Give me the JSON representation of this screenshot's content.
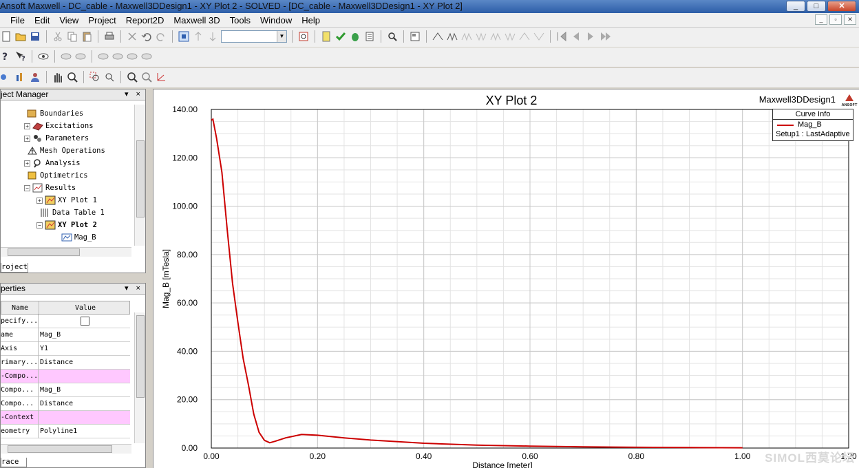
{
  "window": {
    "title": "Ansoft Maxwell - DC_cable - Maxwell3DDesign1 - XY Plot 2 - SOLVED - [DC_cable - Maxwell3DDesign1 - XY Plot 2]",
    "min": "_",
    "max": "□",
    "close": "✕"
  },
  "menu": {
    "items": [
      "File",
      "Edit",
      "View",
      "Project",
      "Report2D",
      "Maxwell 3D",
      "Tools",
      "Window",
      "Help"
    ],
    "mdi": [
      "_",
      "▫",
      "✕"
    ]
  },
  "project_manager": {
    "header": "ject Manager",
    "buttons": "▾ ×",
    "tree": [
      {
        "label": "Boundaries",
        "expand": ""
      },
      {
        "label": "Excitations",
        "expand": "+"
      },
      {
        "label": "Parameters",
        "expand": "+"
      },
      {
        "label": "Mesh Operations",
        "expand": ""
      },
      {
        "label": "Analysis",
        "expand": "+"
      },
      {
        "label": "Optimetrics",
        "expand": ""
      },
      {
        "label": "Results",
        "expand": "−"
      },
      {
        "label": "XY Plot 1",
        "expand": "+"
      },
      {
        "label": "Data Table 1",
        "expand": ""
      },
      {
        "label": "XY Plot 2",
        "expand": "−"
      },
      {
        "label": "Mag_B",
        "expand": ""
      }
    ],
    "tab": "roject"
  },
  "properties": {
    "header": "perties",
    "buttons": "▾ ×",
    "columns": [
      "Name",
      "Value"
    ],
    "rows": [
      {
        "name": "pecify...",
        "value": ""
      },
      {
        "name": "ame",
        "value": "Mag_B"
      },
      {
        "name": " Axis",
        "value": "Y1"
      },
      {
        "name": "rimary...",
        "value": "Distance"
      },
      {
        "name": "-Compo...",
        "value": ""
      },
      {
        "name": " Compo...",
        "value": "Mag_B"
      },
      {
        "name": " Compo...",
        "value": "Distance"
      },
      {
        "name": "-Context",
        "value": ""
      },
      {
        "name": "eometry",
        "value": "Polyline1"
      }
    ],
    "tab": "race"
  },
  "plot": {
    "design": "Maxwell3DDesign1",
    "logo_text": "ANSOFT",
    "legend_title": "Curve Info",
    "legend_series": "Mag_B",
    "legend_setup": "Setup1 : LastAdaptive",
    "watermark": "SIMOL西莫论坛",
    "line_color": "#cc0000"
  },
  "chart_data": {
    "type": "line",
    "title": "XY Plot 2",
    "xlabel": "Distance [meter]",
    "ylabel": "Mag_B [mTesla]",
    "xlim": [
      0,
      1.2
    ],
    "ylim": [
      0,
      140
    ],
    "xticks": [
      "0.00",
      "0.20",
      "0.40",
      "0.60",
      "0.80",
      "1.00",
      "1.20"
    ],
    "yticks": [
      "0.00",
      "20.00",
      "40.00",
      "60.00",
      "80.00",
      "100.00",
      "120.00",
      "140.00"
    ],
    "grid": true,
    "legend_position": "top-right",
    "series": [
      {
        "name": "Mag_B",
        "x": [
          0.0,
          0.003,
          0.01,
          0.02,
          0.03,
          0.04,
          0.05,
          0.06,
          0.07,
          0.08,
          0.09,
          0.1,
          0.11,
          0.12,
          0.14,
          0.17,
          0.2,
          0.25,
          0.3,
          0.4,
          0.5,
          0.6,
          0.7,
          0.8,
          0.9,
          1.0
        ],
        "y": [
          135.5,
          136.0,
          128.0,
          114.0,
          90.0,
          68.0,
          52.0,
          37.0,
          26.0,
          14.0,
          6.5,
          3.2,
          2.2,
          2.8,
          4.2,
          5.6,
          5.3,
          4.2,
          3.3,
          2.0,
          1.2,
          0.8,
          0.5,
          0.3,
          0.2,
          0.1
        ]
      }
    ]
  }
}
